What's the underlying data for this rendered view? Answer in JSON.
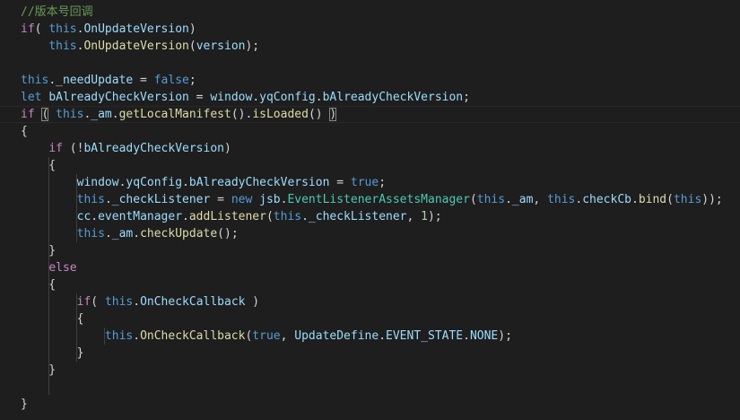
{
  "editor": {
    "colors": {
      "background": "#1e1e1e",
      "comment": "#6a9955",
      "keyword": "#569cd6",
      "control": "#c586c0",
      "variable": "#9cdcfe",
      "function": "#dcdcaa",
      "type": "#4ec9b0",
      "number": "#b5cea8",
      "plain": "#d4d4d4"
    },
    "lines": [
      {
        "tokens": [
          {
            "t": "//版本号回调",
            "c": "comment"
          }
        ]
      },
      {
        "tokens": [
          {
            "t": "if",
            "c": "control"
          },
          {
            "t": "( ",
            "c": "plain"
          },
          {
            "t": "this",
            "c": "keyword"
          },
          {
            "t": ".",
            "c": "plain"
          },
          {
            "t": "OnUpdateVersion",
            "c": "variable"
          },
          {
            "t": ")",
            "c": "plain"
          }
        ]
      },
      {
        "tokens": [
          {
            "t": "    ",
            "c": "plain"
          },
          {
            "t": "this",
            "c": "keyword"
          },
          {
            "t": ".",
            "c": "plain"
          },
          {
            "t": "OnUpdateVersion",
            "c": "function"
          },
          {
            "t": "(",
            "c": "plain"
          },
          {
            "t": "version",
            "c": "variable"
          },
          {
            "t": ");",
            "c": "plain"
          }
        ]
      },
      {
        "tokens": []
      },
      {
        "tokens": [
          {
            "t": "this",
            "c": "keyword"
          },
          {
            "t": ".",
            "c": "plain"
          },
          {
            "t": "_needUpdate",
            "c": "variable"
          },
          {
            "t": " = ",
            "c": "plain"
          },
          {
            "t": "false",
            "c": "keyword"
          },
          {
            "t": ";",
            "c": "plain"
          }
        ]
      },
      {
        "tokens": [
          {
            "t": "let",
            "c": "keyword"
          },
          {
            "t": " ",
            "c": "plain"
          },
          {
            "t": "bAlreadyCheckVersion",
            "c": "variable"
          },
          {
            "t": " = ",
            "c": "plain"
          },
          {
            "t": "window",
            "c": "variable"
          },
          {
            "t": ".",
            "c": "plain"
          },
          {
            "t": "yqConfig",
            "c": "variable"
          },
          {
            "t": ".",
            "c": "plain"
          },
          {
            "t": "bAlreadyCheckVersion",
            "c": "variable"
          },
          {
            "t": ";",
            "c": "plain"
          }
        ]
      },
      {
        "current": true,
        "tokens": [
          {
            "t": "if",
            "c": "control"
          },
          {
            "t": " ",
            "c": "plain"
          },
          {
            "t": "(",
            "c": "plain",
            "bm": true
          },
          {
            "t": " ",
            "c": "plain"
          },
          {
            "t": "this",
            "c": "keyword"
          },
          {
            "t": ".",
            "c": "plain"
          },
          {
            "t": "_am",
            "c": "variable"
          },
          {
            "t": ".",
            "c": "plain"
          },
          {
            "t": "getLocalManifest",
            "c": "function"
          },
          {
            "t": "().",
            "c": "plain"
          },
          {
            "t": "isLoaded",
            "c": "function"
          },
          {
            "t": "() ",
            "c": "plain"
          },
          {
            "t": ")",
            "c": "plain",
            "bm": true
          }
        ]
      },
      {
        "tokens": [
          {
            "t": "{",
            "c": "plain"
          }
        ]
      },
      {
        "tokens": [
          {
            "t": "    ",
            "c": "plain"
          },
          {
            "t": "if",
            "c": "control"
          },
          {
            "t": " (!",
            "c": "plain"
          },
          {
            "t": "bAlreadyCheckVersion",
            "c": "variable"
          },
          {
            "t": ")",
            "c": "plain"
          }
        ]
      },
      {
        "tokens": [
          {
            "t": "    {",
            "c": "plain"
          }
        ]
      },
      {
        "tokens": [
          {
            "t": "        ",
            "c": "plain"
          },
          {
            "t": "window",
            "c": "variable"
          },
          {
            "t": ".",
            "c": "plain"
          },
          {
            "t": "yqConfig",
            "c": "variable"
          },
          {
            "t": ".",
            "c": "plain"
          },
          {
            "t": "bAlreadyCheckVersion",
            "c": "variable"
          },
          {
            "t": " = ",
            "c": "plain"
          },
          {
            "t": "true",
            "c": "keyword"
          },
          {
            "t": ";",
            "c": "plain"
          }
        ]
      },
      {
        "tokens": [
          {
            "t": "        ",
            "c": "plain"
          },
          {
            "t": "this",
            "c": "keyword"
          },
          {
            "t": ".",
            "c": "plain"
          },
          {
            "t": "_checkListener",
            "c": "variable"
          },
          {
            "t": " = ",
            "c": "plain"
          },
          {
            "t": "new",
            "c": "keyword"
          },
          {
            "t": " ",
            "c": "plain"
          },
          {
            "t": "jsb",
            "c": "variable"
          },
          {
            "t": ".",
            "c": "plain"
          },
          {
            "t": "EventListenerAssetsManager",
            "c": "type"
          },
          {
            "t": "(",
            "c": "plain"
          },
          {
            "t": "this",
            "c": "keyword"
          },
          {
            "t": ".",
            "c": "plain"
          },
          {
            "t": "_am",
            "c": "variable"
          },
          {
            "t": ", ",
            "c": "plain"
          },
          {
            "t": "this",
            "c": "keyword"
          },
          {
            "t": ".",
            "c": "plain"
          },
          {
            "t": "checkCb",
            "c": "variable"
          },
          {
            "t": ".",
            "c": "plain"
          },
          {
            "t": "bind",
            "c": "function"
          },
          {
            "t": "(",
            "c": "plain"
          },
          {
            "t": "this",
            "c": "keyword"
          },
          {
            "t": "));",
            "c": "plain"
          }
        ]
      },
      {
        "tokens": [
          {
            "t": "        ",
            "c": "plain"
          },
          {
            "t": "cc",
            "c": "variable"
          },
          {
            "t": ".",
            "c": "plain"
          },
          {
            "t": "eventManager",
            "c": "variable"
          },
          {
            "t": ".",
            "c": "plain"
          },
          {
            "t": "addListener",
            "c": "function"
          },
          {
            "t": "(",
            "c": "plain"
          },
          {
            "t": "this",
            "c": "keyword"
          },
          {
            "t": ".",
            "c": "plain"
          },
          {
            "t": "_checkListener",
            "c": "variable"
          },
          {
            "t": ", ",
            "c": "plain"
          },
          {
            "t": "1",
            "c": "number"
          },
          {
            "t": ");",
            "c": "plain"
          }
        ]
      },
      {
        "tokens": [
          {
            "t": "        ",
            "c": "plain"
          },
          {
            "t": "this",
            "c": "keyword"
          },
          {
            "t": ".",
            "c": "plain"
          },
          {
            "t": "_am",
            "c": "variable"
          },
          {
            "t": ".",
            "c": "plain"
          },
          {
            "t": "checkUpdate",
            "c": "function"
          },
          {
            "t": "();",
            "c": "plain"
          }
        ]
      },
      {
        "tokens": [
          {
            "t": "    }",
            "c": "plain"
          }
        ]
      },
      {
        "tokens": [
          {
            "t": "    ",
            "c": "plain"
          },
          {
            "t": "else",
            "c": "control"
          }
        ]
      },
      {
        "tokens": [
          {
            "t": "    {",
            "c": "plain"
          }
        ]
      },
      {
        "tokens": [
          {
            "t": "        ",
            "c": "plain"
          },
          {
            "t": "if",
            "c": "control"
          },
          {
            "t": "( ",
            "c": "plain"
          },
          {
            "t": "this",
            "c": "keyword"
          },
          {
            "t": ".",
            "c": "plain"
          },
          {
            "t": "OnCheckCallback",
            "c": "variable"
          },
          {
            "t": " )",
            "c": "plain"
          }
        ]
      },
      {
        "tokens": [
          {
            "t": "        {",
            "c": "plain"
          }
        ]
      },
      {
        "tokens": [
          {
            "t": "            ",
            "c": "plain"
          },
          {
            "t": "this",
            "c": "keyword"
          },
          {
            "t": ".",
            "c": "plain"
          },
          {
            "t": "OnCheckCallback",
            "c": "function"
          },
          {
            "t": "(",
            "c": "plain"
          },
          {
            "t": "true",
            "c": "keyword"
          },
          {
            "t": ", ",
            "c": "plain"
          },
          {
            "t": "UpdateDefine",
            "c": "variable"
          },
          {
            "t": ".",
            "c": "plain"
          },
          {
            "t": "EVENT_STATE",
            "c": "variable"
          },
          {
            "t": ".",
            "c": "plain"
          },
          {
            "t": "NONE",
            "c": "variable"
          },
          {
            "t": ");",
            "c": "plain"
          }
        ]
      },
      {
        "tokens": [
          {
            "t": "        }",
            "c": "plain"
          }
        ]
      },
      {
        "tokens": [
          {
            "t": "    }",
            "c": "plain"
          }
        ]
      },
      {
        "tokens": []
      },
      {
        "tokens": [
          {
            "t": "}",
            "c": "plain"
          }
        ]
      }
    ]
  }
}
